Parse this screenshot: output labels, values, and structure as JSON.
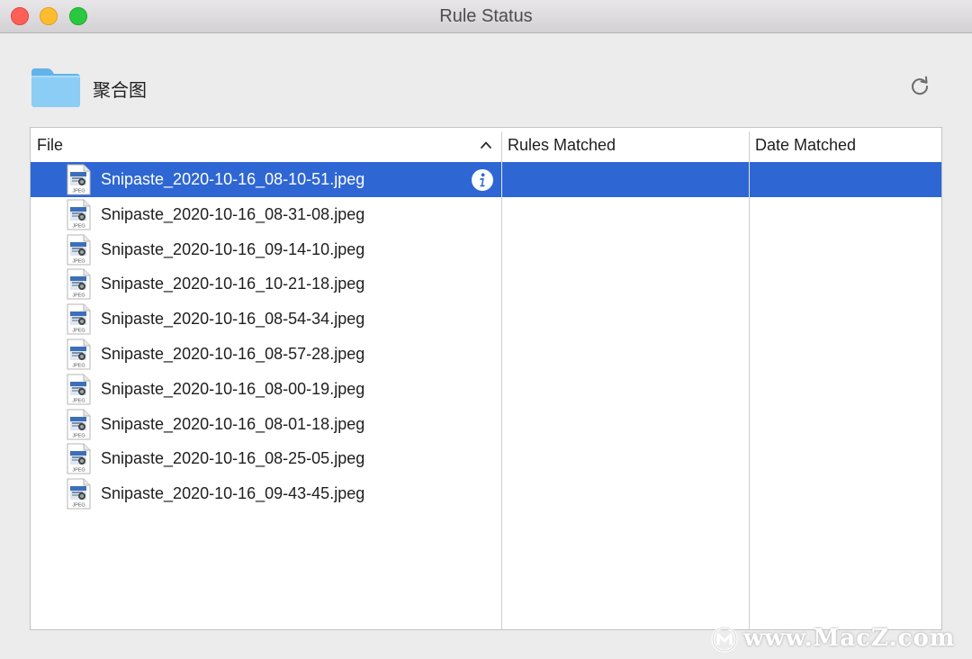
{
  "window": {
    "title": "Rule Status"
  },
  "header": {
    "folder_name": "聚合图",
    "folder_icon": "folder-icon",
    "refresh_icon": "refresh-icon"
  },
  "table": {
    "columns": [
      {
        "label": "File",
        "sorted": "ascending"
      },
      {
        "label": "Rules Matched"
      },
      {
        "label": "Date Matched"
      }
    ],
    "rows": [
      {
        "file": "Snipaste_2020-10-16_08-10-51.jpeg",
        "rules_matched": "",
        "date_matched": "",
        "selected": true
      },
      {
        "file": "Snipaste_2020-10-16_08-31-08.jpeg",
        "rules_matched": "",
        "date_matched": ""
      },
      {
        "file": "Snipaste_2020-10-16_09-14-10.jpeg",
        "rules_matched": "",
        "date_matched": ""
      },
      {
        "file": "Snipaste_2020-10-16_10-21-18.jpeg",
        "rules_matched": "",
        "date_matched": ""
      },
      {
        "file": "Snipaste_2020-10-16_08-54-34.jpeg",
        "rules_matched": "",
        "date_matched": ""
      },
      {
        "file": "Snipaste_2020-10-16_08-57-28.jpeg",
        "rules_matched": "",
        "date_matched": ""
      },
      {
        "file": "Snipaste_2020-10-16_08-00-19.jpeg",
        "rules_matched": "",
        "date_matched": ""
      },
      {
        "file": "Snipaste_2020-10-16_08-01-18.jpeg",
        "rules_matched": "",
        "date_matched": ""
      },
      {
        "file": "Snipaste_2020-10-16_08-25-05.jpeg",
        "rules_matched": "",
        "date_matched": ""
      },
      {
        "file": "Snipaste_2020-10-16_09-43-45.jpeg",
        "rules_matched": "",
        "date_matched": ""
      }
    ],
    "file_type_badge": "JPEG"
  },
  "watermark": {
    "text": "www.MacZ.com"
  },
  "colors": {
    "selection": "#2e66d4",
    "close": "#fe5f57",
    "minimize": "#febc2e",
    "maximize": "#28c840"
  }
}
